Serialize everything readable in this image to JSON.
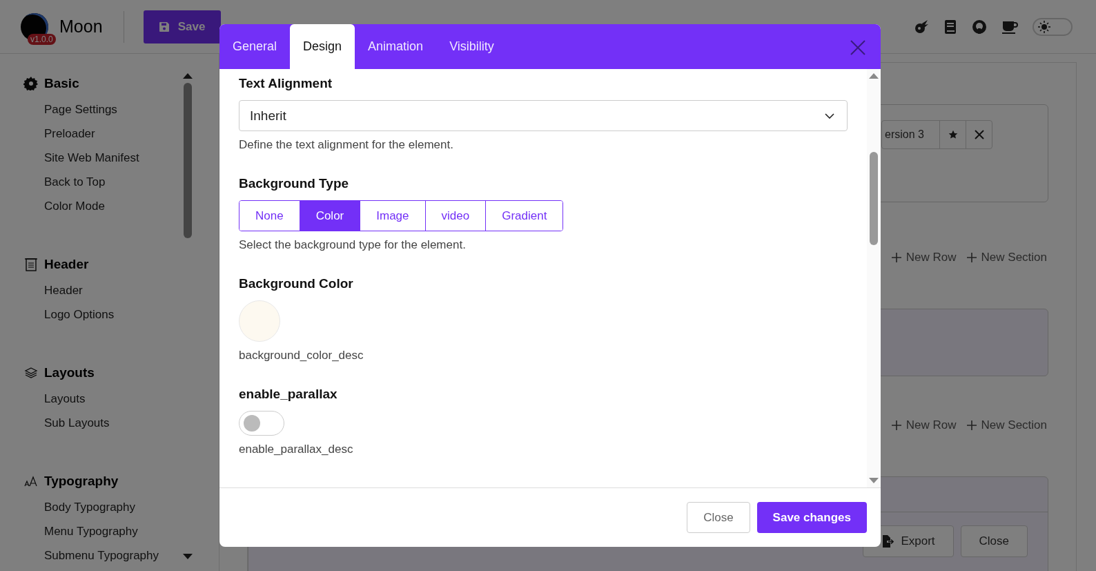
{
  "app": {
    "logo": {
      "name": "Moon",
      "version": "v1.0.0"
    },
    "save_button": "Save",
    "dark_mode": false,
    "sidebar": [
      {
        "title": "Basic",
        "items": [
          "Page Settings",
          "Preloader",
          "Site Web Manifest",
          "Back to Top",
          "Color Mode"
        ]
      },
      {
        "title": "Header",
        "items": [
          "Header",
          "Logo Options"
        ]
      },
      {
        "title": "Layouts",
        "items": [
          "Layouts",
          "Sub Layouts"
        ]
      },
      {
        "title": "Typography",
        "items": [
          "Body Typography",
          "Menu Typography",
          "Submenu Typography"
        ]
      }
    ],
    "canvas": {
      "version_tab": "ersion 3",
      "row_actions": [
        {
          "new_row": "New Row",
          "new_section": "New Section"
        },
        {
          "new_row": "New Row",
          "new_section": "New Section"
        }
      ],
      "footer_buttons": [
        "Export",
        "Close"
      ]
    }
  },
  "modal": {
    "tabs": [
      {
        "label": "General",
        "selected": false
      },
      {
        "label": "Design",
        "selected": true
      },
      {
        "label": "Animation",
        "selected": false
      },
      {
        "label": "Visibility",
        "selected": false
      }
    ],
    "fields": [
      {
        "kind": "select",
        "label": "Text Alignment",
        "value": "Inherit",
        "description": "Define the text alignment for the element."
      },
      {
        "kind": "segmented",
        "label": "Background Type",
        "options": [
          {
            "label": "None",
            "selected": false
          },
          {
            "label": "Color",
            "selected": true
          },
          {
            "label": "Image",
            "selected": false
          },
          {
            "label": "video",
            "selected": false
          },
          {
            "label": "Gradient",
            "selected": false
          }
        ],
        "description": "Select the background type for the element."
      },
      {
        "kind": "color",
        "label": "Background Color",
        "color": "#fdf9f0",
        "description": "background_color_desc"
      },
      {
        "kind": "toggle",
        "label": "enable_parallax",
        "on": false,
        "description": "enable_parallax_desc"
      }
    ],
    "buttons": {
      "close": "Close",
      "save": "Save changes"
    }
  }
}
